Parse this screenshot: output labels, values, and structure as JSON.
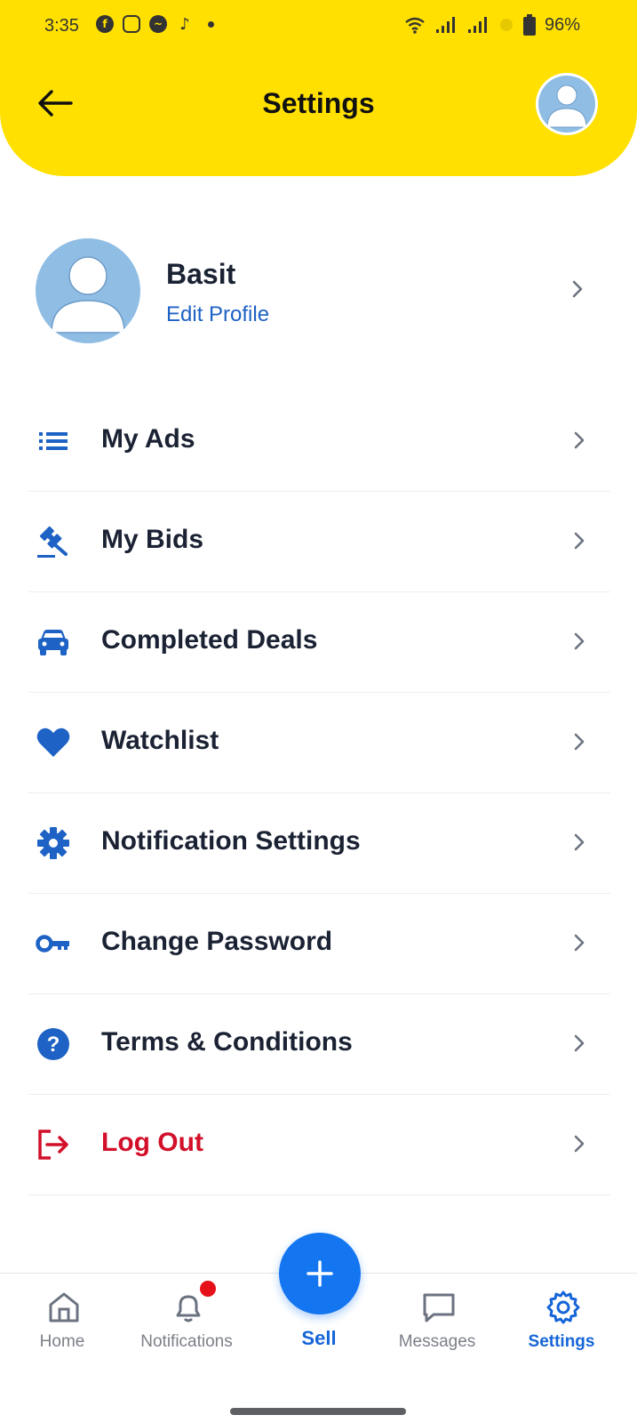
{
  "status_bar": {
    "time": "3:35",
    "apps": [
      "facebook-icon",
      "instagram-icon",
      "messenger-icon",
      "tiktok-icon"
    ],
    "battery": "96%"
  },
  "header": {
    "title": "Settings",
    "background": "#FFE000"
  },
  "profile": {
    "name": "Basit",
    "edit_label": "Edit Profile"
  },
  "menu": [
    {
      "label": "My Ads",
      "icon": "list-icon"
    },
    {
      "label": "My Bids",
      "icon": "gavel-icon"
    },
    {
      "label": "Completed Deals",
      "icon": "car-icon"
    },
    {
      "label": "Watchlist",
      "icon": "heart-icon"
    },
    {
      "label": "Notification Settings",
      "icon": "gear-icon"
    },
    {
      "label": "Change Password",
      "icon": "key-icon"
    },
    {
      "label": "Terms & Conditions",
      "icon": "question-icon"
    },
    {
      "label": "Log Out",
      "icon": "logout-icon",
      "color": "#d2102a"
    }
  ],
  "bottom_nav": {
    "items": [
      {
        "label": "Home",
        "icon": "home-icon"
      },
      {
        "label": "Notifications",
        "icon": "bell-icon"
      },
      {
        "label": "Sell",
        "icon": "plus-icon"
      },
      {
        "label": "Messages",
        "icon": "chat-icon"
      },
      {
        "label": "Settings",
        "icon": "gear-icon",
        "active": true
      }
    ]
  },
  "colors": {
    "accent": "#1565d8",
    "danger": "#d2102a",
    "sell_button": "#1475f0"
  }
}
